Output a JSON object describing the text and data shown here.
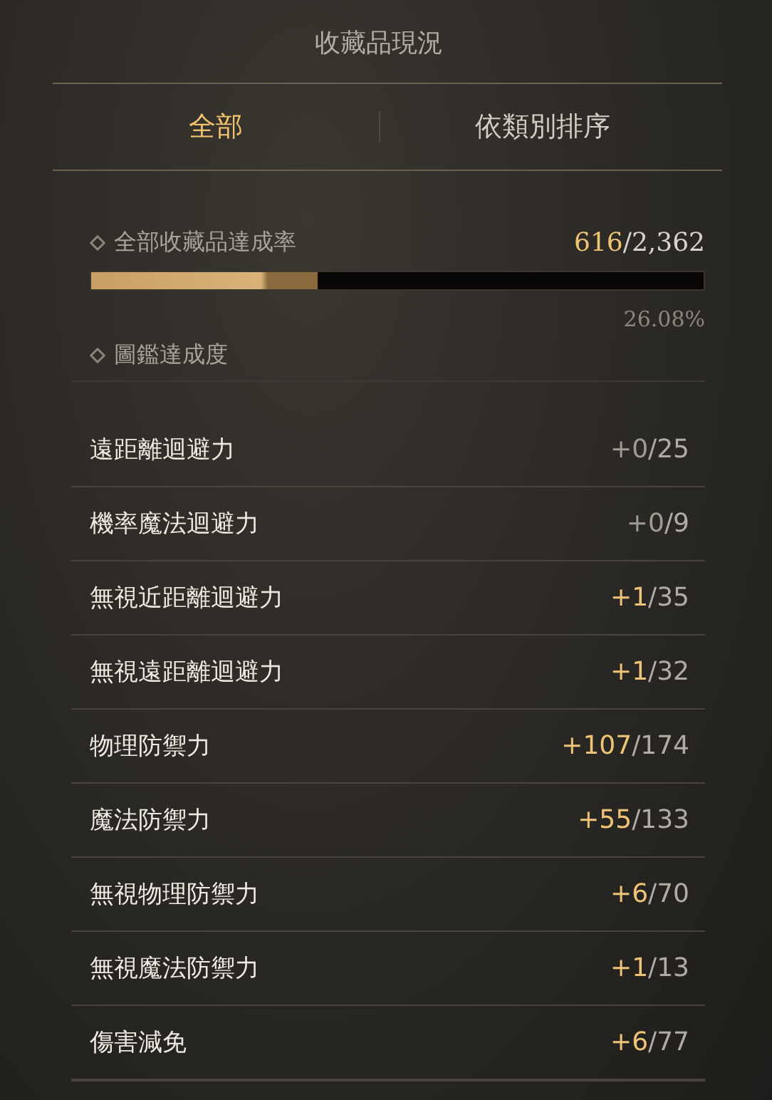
{
  "title": "收藏品現況",
  "tabs": [
    {
      "label": "全部",
      "selected": true
    },
    {
      "label": "依類別排序",
      "selected": false
    }
  ],
  "overall": {
    "label": "全部收藏品達成率",
    "current": "616",
    "total": "/2,362",
    "level": 0.37,
    "percent": "26.08%"
  },
  "codex": {
    "label": "圖鑑達成度"
  },
  "stats": [
    {
      "name": "遠距離迴避力",
      "gain": "+0",
      "total": "/25",
      "highlight": false
    },
    {
      "name": "機率魔法迴避力",
      "gain": "+0",
      "total": "/9",
      "highlight": false
    },
    {
      "name": "無視近距離迴避力",
      "gain": "+1",
      "total": "/35",
      "highlight": true
    },
    {
      "name": "無視遠距離迴避力",
      "gain": "+1",
      "total": "/32",
      "highlight": true
    },
    {
      "name": "物理防禦力",
      "gain": "+107",
      "total": "/174",
      "highlight": true
    },
    {
      "name": "魔法防禦力",
      "gain": "+55",
      "total": "/133",
      "highlight": true
    },
    {
      "name": "無視物理防禦力",
      "gain": "+6",
      "total": "/70",
      "highlight": true
    },
    {
      "name": "無視魔法防禦力",
      "gain": "+1",
      "total": "/13",
      "highlight": true
    },
    {
      "name": "傷害減免",
      "gain": "+6",
      "total": "/77",
      "highlight": true
    }
  ]
}
